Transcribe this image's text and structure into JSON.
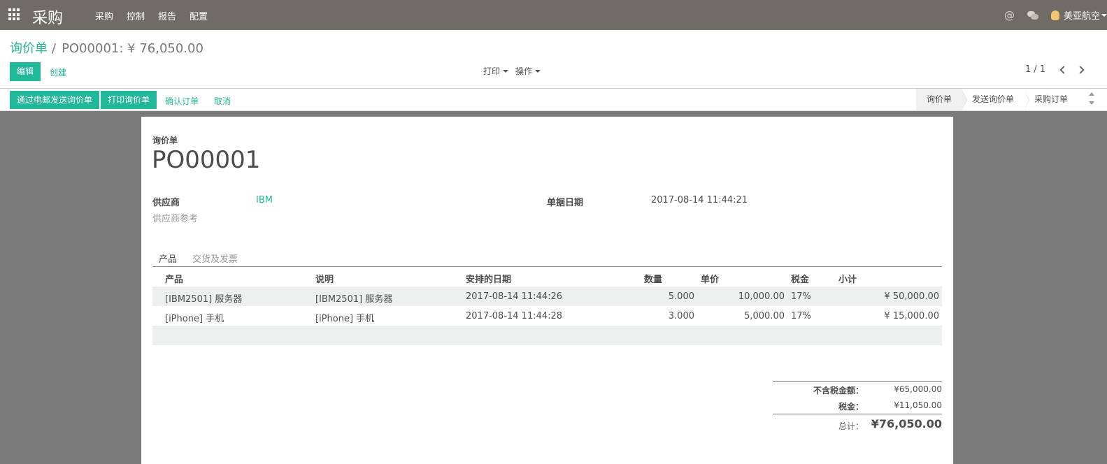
{
  "navbar": {
    "app_title": "采购",
    "menu": [
      "采购",
      "控制",
      "报告",
      "配置"
    ],
    "at_symbol": "@",
    "user": "美亚航空"
  },
  "control": {
    "breadcrumb_parent": "询价单",
    "breadcrumb_sep": "/",
    "breadcrumb_current": "PO00001: ¥ 76,050.00",
    "edit": "编辑",
    "create": "创建",
    "print": "打印",
    "action": "操作",
    "pager": "1 / 1"
  },
  "statusbar": {
    "send_email": "通过电邮发送询价单",
    "print_rfq": "打印询价单",
    "confirm": "确认订单",
    "cancel": "取消",
    "stages": [
      "询价单",
      "发送询价单",
      "采购订单"
    ]
  },
  "sheet": {
    "doc_label": "询价单",
    "doc_name": "PO00001",
    "vendor_label": "供应商",
    "vendor_value": "IBM",
    "vendor_ref_label": "供应商参考",
    "order_date_label": "单据日期",
    "order_date_value": "2017-08-14 11:44:21",
    "tabs": [
      "产品",
      "交货及发票"
    ],
    "columns": [
      "产品",
      "说明",
      "安排的日期",
      "数量",
      "单价",
      "税金",
      "小计"
    ],
    "lines": [
      {
        "product": "[IBM2501] 服务器",
        "description": "[IBM2501] 服务器",
        "date": "2017-08-14 11:44:26",
        "qty": "5.000",
        "price": "10,000.00",
        "tax": "17%",
        "subtotal": "¥ 50,000.00"
      },
      {
        "product": "[iPhone] 手机",
        "description": "[iPhone] 手机",
        "date": "2017-08-14 11:44:28",
        "qty": "3.000",
        "price": "5,000.00",
        "tax": "17%",
        "subtotal": "¥ 15,000.00"
      }
    ],
    "totals": {
      "untaxed_label": "不含税金额：",
      "untaxed_value": "¥65,000.00",
      "tax_label": "税金：",
      "tax_value": "¥11,050.00",
      "total_label": "总计：",
      "total_value": "¥76,050.00"
    }
  },
  "colors": {
    "navbar": "#6f6b66",
    "accent": "#21b799"
  }
}
